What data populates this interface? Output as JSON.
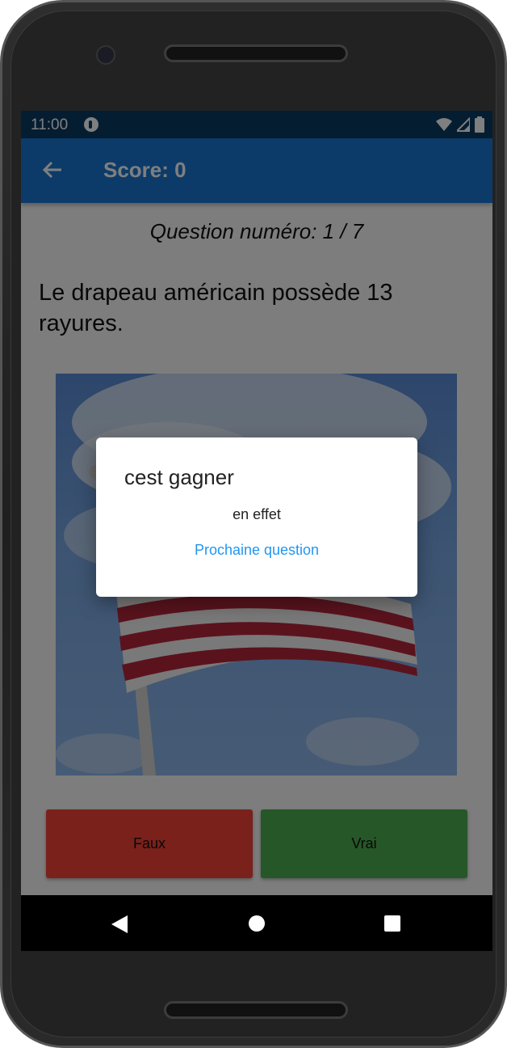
{
  "status_bar": {
    "time": "11:00"
  },
  "app_bar": {
    "title": "Score: 0"
  },
  "quiz": {
    "question_number": "Question numéro: 1 / 7",
    "question_text": "Le drapeau américain possède 13 rayures.",
    "image": "american-flag-photo"
  },
  "answers": {
    "false_label": "Faux",
    "true_label": "Vrai"
  },
  "dialog": {
    "title": "cest gagner",
    "content": "en effet",
    "action_label": "Prochaine question"
  },
  "colors": {
    "primary": "#1976d2",
    "status_bar": "#0a3b62",
    "faux_button": "#f44336",
    "vrai_button": "#4caf50",
    "dialog_action": "#2196f3"
  }
}
